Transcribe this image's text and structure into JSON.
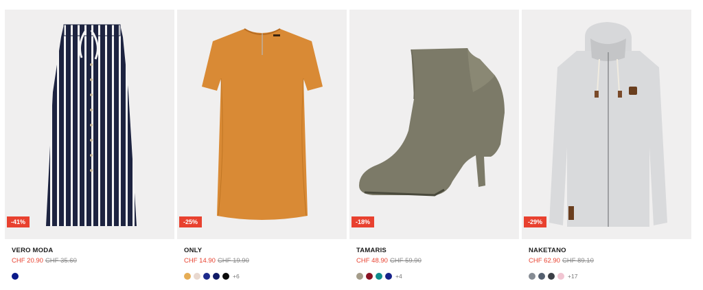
{
  "products": [
    {
      "brand": "VERO MODA",
      "price": "CHF 20.90",
      "old_price": "CHF 35.60",
      "discount": "-41%",
      "image": "striped-skirt",
      "swatches": [
        "#0b1a8a"
      ],
      "more": ""
    },
    {
      "brand": "ONLY",
      "price": "CHF 14.90",
      "old_price": "CHF 19.90",
      "discount": "-25%",
      "image": "orange-top",
      "swatches": [
        "#e6ad55",
        "#e8d8cf",
        "#1d2a8c",
        "#101a66",
        "#0a0a0a"
      ],
      "more": "+6"
    },
    {
      "brand": "TAMARIS",
      "price": "CHF 48.90",
      "old_price": "CHF 59.90",
      "discount": "-18%",
      "image": "ankle-boot",
      "swatches": [
        "#a49c8a",
        "#8a1222",
        "#0f8c8c",
        "#17238a"
      ],
      "more": "+4"
    },
    {
      "brand": "NAKETANO",
      "price": "CHF 62.90",
      "old_price": "CHF 89.10",
      "discount": "-29%",
      "image": "grey-hoodie",
      "swatches": [
        "#868c94",
        "#556070",
        "#3b3f46",
        "#f1c5d2"
      ],
      "more": "+17"
    }
  ],
  "colors": {
    "accent": "#e8412f",
    "card_bg": "#f0efef"
  }
}
